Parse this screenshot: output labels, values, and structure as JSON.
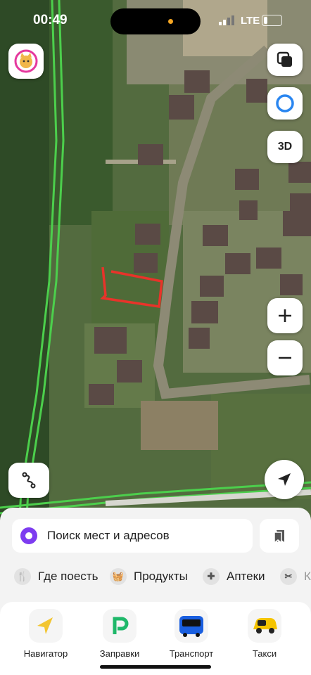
{
  "status_bar": {
    "time": "00:49",
    "network": "LTE"
  },
  "map": {
    "left_3d_button": "3D",
    "colors": {
      "road_green": "#4ccf4c",
      "plot_outline": "#e8332a"
    }
  },
  "search": {
    "placeholder": "Поиск мест и адресов"
  },
  "chips": [
    {
      "label": "Где поесть",
      "icon": "fork-knife-icon"
    },
    {
      "label": "Продукты",
      "icon": "basket-icon"
    },
    {
      "label": "Аптеки",
      "icon": "plus-cross-icon"
    },
    {
      "label": "К",
      "icon": "scissors-icon"
    }
  ],
  "dock": [
    {
      "label": "Навигатор",
      "icon": "navigator-arrow-icon"
    },
    {
      "label": "Заправки",
      "icon": "fuel-station-icon"
    },
    {
      "label": "Транспорт",
      "icon": "bus-icon"
    },
    {
      "label": "Такси",
      "icon": "taxi-car-icon"
    }
  ]
}
